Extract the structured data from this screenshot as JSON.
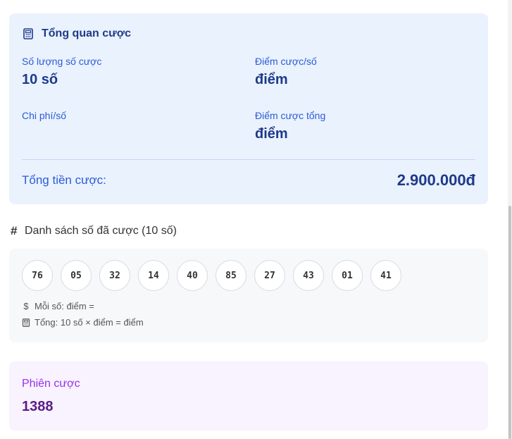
{
  "summary": {
    "title": "Tổng quan cược",
    "icon": "calculator-icon",
    "stats": {
      "count": {
        "label": "Số lượng số cược",
        "value": "10 số"
      },
      "points_per": {
        "label": "Điểm cược/số",
        "value": "điểm"
      },
      "cost_per": {
        "label": "Chi phí/số",
        "value": ""
      },
      "points_total": {
        "label": "Điểm cược tổng",
        "value": "điểm"
      }
    },
    "total_label": "Tổng tiền cược:",
    "total_value": "2.900.000đ"
  },
  "numbers": {
    "title": "Danh sách số đã cược (10 số)",
    "items": [
      "76",
      "05",
      "32",
      "14",
      "40",
      "85",
      "27",
      "43",
      "01",
      "41"
    ],
    "note_per": "Mỗi số: điểm =",
    "note_total": "Tổng: 10 số × điểm = điểm"
  },
  "session": {
    "label": "Phiên cược",
    "value": "1388"
  },
  "colors": {
    "summary_bg": "#eaf2fe",
    "accent_blue": "#2a5bd7",
    "dark_blue": "#1e3a8a",
    "session_bg": "#f9f2ff",
    "session_purple": "#9333ea"
  }
}
